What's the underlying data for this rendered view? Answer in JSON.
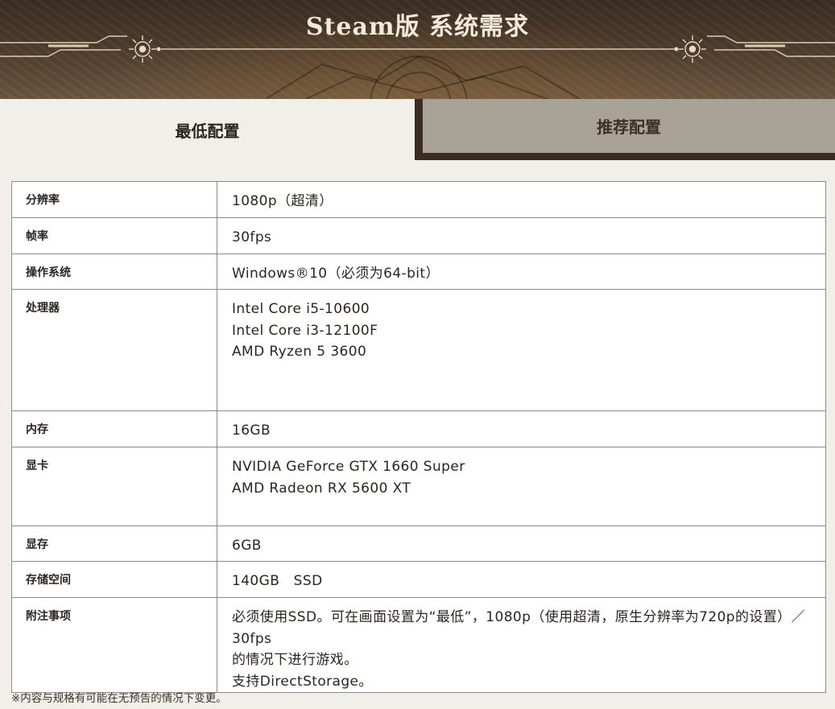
{
  "header": {
    "title": "Steam版 系统需求"
  },
  "tabs": [
    {
      "label": "最低配置",
      "active": true
    },
    {
      "label": "推荐配置",
      "active": false
    }
  ],
  "specs": [
    {
      "key": "分辨率",
      "lines": [
        "1080p（超清）"
      ]
    },
    {
      "key": "帧率",
      "lines": [
        "30fps"
      ]
    },
    {
      "key": "操作系统",
      "lines": [
        "Windows®10（必须为64-bit）"
      ]
    },
    {
      "key": "处理器",
      "lines": [
        "Intel Core i5-10600",
        "Intel Core i3-12100F",
        "AMD Ryzen 5 3600"
      ]
    },
    {
      "key": "内存",
      "lines": [
        "16GB"
      ]
    },
    {
      "key": "显卡",
      "lines": [
        "NVIDIA GeForce GTX 1660 Super",
        "AMD Radeon RX 5600 XT"
      ]
    },
    {
      "key": "显存",
      "lines": [
        "6GB"
      ]
    },
    {
      "key": "存储空间",
      "lines": [
        "140GB　SSD"
      ]
    },
    {
      "key": "附注事项",
      "lines": [
        "必须使用SSD。可在画面设置为“最低”，1080p（使用超清，原生分辨率为720p的设置）／30fps",
        "的情况下进行游戏。",
        "支持DirectStorage。"
      ]
    }
  ],
  "footnote": "※内容与规格有可能在无预告的情况下变更。",
  "colors": {
    "banner_dark": "#3b2d22",
    "page_bg": "#f1efea",
    "inactive_tab": "#a9a397",
    "title_text": "#f3ead8"
  }
}
